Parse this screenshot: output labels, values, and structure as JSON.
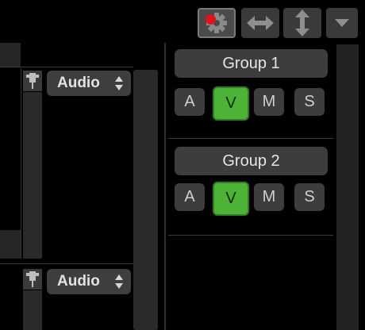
{
  "toolbar": {
    "buttons": [
      {
        "icon": "gear-with-red-dot-icon",
        "active": true
      },
      {
        "icon": "horizontal-resize-arrows-icon"
      },
      {
        "icon": "vertical-resize-arrows-icon"
      },
      {
        "icon": "dropdown-triangle-icon"
      }
    ]
  },
  "tracks": [
    {
      "type_select": {
        "value": "Audio"
      }
    },
    {
      "type_select": {
        "value": "Audio"
      }
    }
  ],
  "groups": [
    {
      "title": "Group 1",
      "buttons": [
        "A",
        "V",
        "M",
        "S"
      ],
      "active": "V"
    },
    {
      "title": "Group 2",
      "buttons": [
        "A",
        "V",
        "M",
        "S"
      ],
      "active": "V"
    }
  ],
  "colors": {
    "background": "#000000",
    "panel": "#262626",
    "button": "#3d3d3d",
    "active_green": "#4cb336",
    "notification_red": "#e0121a"
  }
}
